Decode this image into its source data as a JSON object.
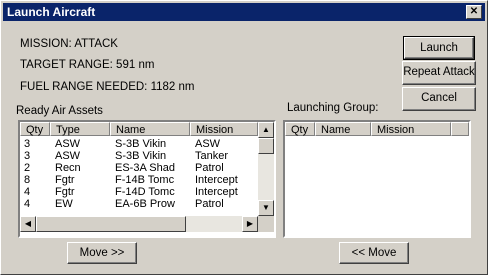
{
  "window": {
    "title": "Launch Aircraft",
    "close_glyph": "✕"
  },
  "info": {
    "mission": "MISSION: ATTACK",
    "target_range": "TARGET RANGE:  591 nm",
    "fuel_range": "FUEL RANGE NEEDED: 1182 nm"
  },
  "buttons": {
    "launch": "Launch",
    "repeat": "Repeat Attack",
    "cancel": "Cancel",
    "move_right": "Move >>",
    "move_left": "<< Move"
  },
  "ready": {
    "label": "Ready Air Assets",
    "headers": [
      "Qty",
      "Type",
      "Name",
      "Mission"
    ],
    "rows": [
      [
        "3",
        "ASW",
        "S-3B Vikin",
        "ASW"
      ],
      [
        "3",
        "ASW",
        "S-3B Vikin",
        "Tanker"
      ],
      [
        "2",
        "Recn",
        "ES-3A Shad",
        "Patrol"
      ],
      [
        "8",
        "Fgtr",
        "F-14B Tomc",
        "Intercept"
      ],
      [
        "4",
        "Fgtr",
        "F-14D Tomc",
        "Intercept"
      ],
      [
        "4",
        "EW",
        "EA-6B Prow",
        "Patrol"
      ]
    ]
  },
  "launching": {
    "label": "Launching Group:",
    "headers": [
      "Qty",
      "Name",
      "Mission"
    ]
  }
}
